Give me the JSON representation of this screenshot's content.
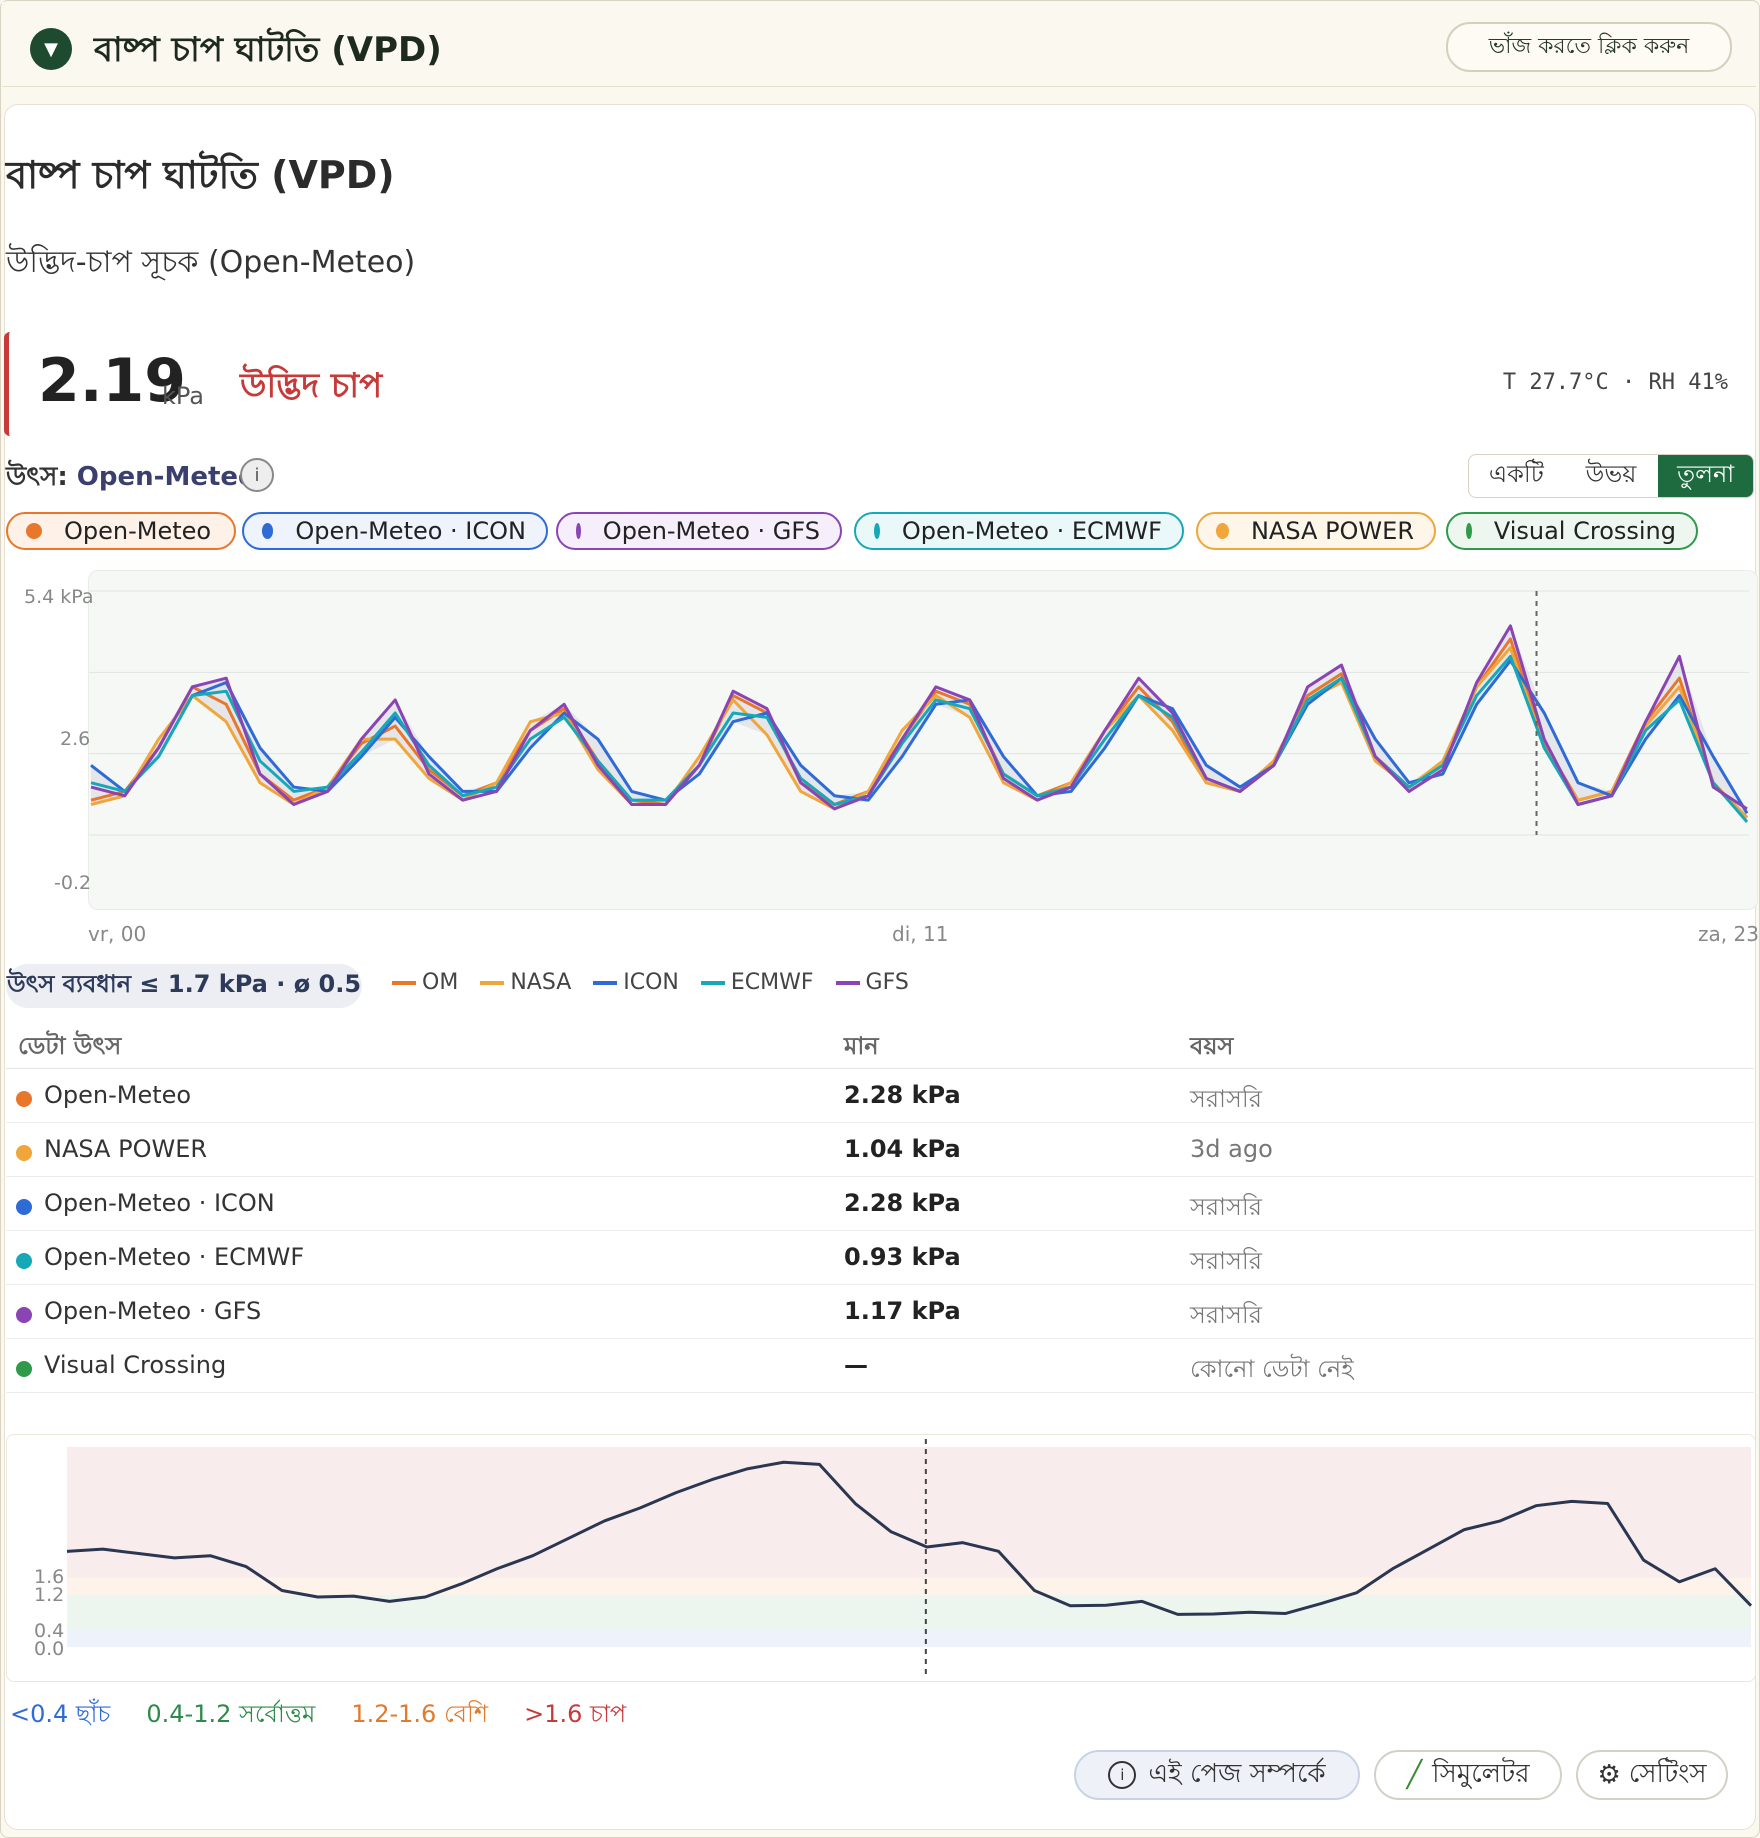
{
  "header": {
    "title": "বাষ্প চাপ ঘাটতি (VPD)",
    "collapse_label": "ভাঁজ করতে ক্লিক করুন",
    "chevron_icon": "chevron-down-icon"
  },
  "card": {
    "title": "বাষ্প চাপ ঘাটতি (VPD)",
    "subtitle": "উদ্ভিদ-চাপ সূচক (Open-Meteo)",
    "value": "2.19",
    "unit": "kPa",
    "status": "উদ্ভিদ চাপ",
    "status_color": "#c73a3a",
    "conditions": "T 27.7°C · RH 41%",
    "source_label": "উৎস:",
    "source_value": "Open-Meteo"
  },
  "view_toggle": {
    "options": [
      "একটি",
      "উভয়",
      "তুলনা"
    ],
    "selected": "তুলনা"
  },
  "chips": [
    {
      "label": "Open-Meteo",
      "color": "#e8772c",
      "bg": "#fdf1e8"
    },
    {
      "label": "Open-Meteo · ICON",
      "color": "#2f6bd6",
      "bg": "#eef3fc"
    },
    {
      "label": "Open-Meteo · GFS",
      "color": "#8a44b4",
      "bg": "#f6eefa"
    },
    {
      "label": "Open-Meteo · ECMWF",
      "color": "#17a8b8",
      "bg": "#ebf8fa"
    },
    {
      "label": "NASA POWER",
      "color": "#f0a63a",
      "bg": "#fdf6e9"
    },
    {
      "label": "Visual Crossing",
      "color": "#2e9a4a",
      "bg": "#edf7ef"
    }
  ],
  "chart_data": [
    {
      "type": "line",
      "title": "",
      "y_ticks": [
        "5.4 kPa",
        "2.6",
        "-0.2"
      ],
      "ylim": [
        -0.2,
        5.4
      ],
      "x_ticks": [
        "vr, 00",
        "di, 11",
        "za, 23"
      ],
      "now_marker_fraction": 0.872,
      "grid": true,
      "series": [
        {
          "name": "OM",
          "color": "#e8772c",
          "values": [
            0.6,
            0.8,
            1.8,
            3.2,
            2.8,
            1.2,
            0.6,
            0.9,
            1.9,
            2.3,
            1.3,
            0.7,
            1.0,
            2.2,
            2.7,
            1.5,
            0.6,
            0.5,
            1.4,
            3.0,
            2.6,
            1.0,
            0.5,
            0.8,
            2.0,
            3.1,
            2.8,
            1.2,
            0.7,
            1.0,
            2.2,
            3.2,
            2.4,
            1.0,
            0.8,
            1.5,
            3.0,
            3.5,
            1.6,
            0.9,
            1.4,
            3.2,
            4.3,
            1.9,
            0.6,
            0.8,
            2.4,
            3.4,
            1.0,
            0.2
          ]
        },
        {
          "name": "NASA",
          "color": "#f0a63a",
          "values": [
            0.5,
            0.7,
            2.0,
            3.0,
            2.4,
            1.0,
            0.5,
            0.9,
            2.0,
            2.0,
            1.1,
            0.6,
            1.0,
            2.4,
            2.6,
            1.3,
            0.5,
            0.5,
            1.6,
            2.9,
            2.1,
            0.8,
            0.4,
            0.8,
            2.2,
            3.0,
            2.5,
            1.0,
            0.6,
            1.0,
            2.2,
            3.0,
            2.2,
            1.0,
            0.8,
            1.5,
            2.9,
            3.3,
            1.5,
            0.9,
            1.5,
            3.2,
            4.1,
            1.8,
            0.6,
            0.8,
            2.3,
            3.2,
            1.0,
            0.2
          ]
        },
        {
          "name": "ICON",
          "color": "#2f6bd6",
          "values": [
            1.4,
            0.8,
            1.6,
            3.0,
            3.3,
            1.8,
            0.9,
            0.8,
            1.6,
            2.5,
            1.6,
            0.8,
            0.8,
            1.8,
            2.6,
            2.0,
            0.8,
            0.6,
            1.2,
            2.4,
            2.6,
            1.4,
            0.7,
            0.6,
            1.6,
            2.8,
            2.9,
            1.6,
            0.7,
            0.8,
            1.8,
            3.0,
            2.7,
            1.4,
            0.9,
            1.4,
            2.8,
            3.4,
            2.0,
            1.0,
            1.2,
            2.8,
            3.8,
            2.6,
            1.0,
            0.7,
            2.0,
            3.0,
            1.6,
            0.3
          ]
        },
        {
          "name": "ECMWF",
          "color": "#17a8b8",
          "values": [
            1.0,
            0.8,
            1.6,
            3.0,
            3.1,
            1.5,
            0.8,
            0.9,
            1.7,
            2.6,
            1.4,
            0.7,
            0.9,
            2.0,
            2.5,
            1.5,
            0.6,
            0.6,
            1.4,
            2.6,
            2.5,
            1.1,
            0.5,
            0.7,
            1.9,
            2.9,
            2.7,
            1.2,
            0.7,
            0.9,
            2.0,
            3.0,
            2.5,
            1.1,
            0.8,
            1.4,
            2.9,
            3.4,
            1.6,
            0.9,
            1.4,
            3.0,
            3.9,
            1.8,
            0.5,
            0.7,
            2.2,
            2.9,
            1.0,
            0.1
          ]
        },
        {
          "name": "GFS",
          "color": "#8a44b4",
          "values": [
            0.9,
            0.7,
            1.8,
            3.2,
            3.4,
            1.2,
            0.5,
            0.8,
            2.0,
            2.9,
            1.2,
            0.6,
            0.8,
            2.2,
            2.8,
            1.4,
            0.5,
            0.5,
            1.4,
            3.1,
            2.7,
            1.0,
            0.4,
            0.7,
            2.0,
            3.2,
            2.9,
            1.1,
            0.6,
            0.9,
            2.2,
            3.4,
            2.6,
            1.1,
            0.8,
            1.4,
            3.2,
            3.7,
            1.6,
            0.8,
            1.3,
            3.3,
            4.6,
            2.0,
            0.5,
            0.7,
            2.4,
            3.9,
            0.9,
            0.4
          ]
        }
      ]
    },
    {
      "type": "line",
      "title": "",
      "y_ticks": [
        "1.6",
        "1.2",
        "0.4",
        "0.0"
      ],
      "zones": [
        {
          "from": 0.0,
          "to": 0.4,
          "label": "<0.4 ছাঁচ"
        },
        {
          "from": 0.4,
          "to": 1.2,
          "label": "0.4-1.2 সর্বোত্তম"
        },
        {
          "from": 1.2,
          "to": 1.6,
          "label": "1.2-1.6 বেশি"
        },
        {
          "from": 1.6,
          "to": 4.6,
          "label": ">1.6 চাপ"
        }
      ],
      "ylim": [
        0,
        4.6
      ],
      "now_marker_fraction": 0.51,
      "series": [
        {
          "name": "VPD",
          "color": "#2b3650",
          "values": [
            2.2,
            2.25,
            2.15,
            2.05,
            2.1,
            1.85,
            1.3,
            1.15,
            1.17,
            1.05,
            1.15,
            1.45,
            1.8,
            2.1,
            2.5,
            2.9,
            3.2,
            3.55,
            3.85,
            4.1,
            4.25,
            4.2,
            3.3,
            2.65,
            2.3,
            2.4,
            2.2,
            1.3,
            0.95,
            0.96,
            1.05,
            0.75,
            0.76,
            0.8,
            0.77,
            1.0,
            1.25,
            1.8,
            2.25,
            2.7,
            2.9,
            3.25,
            3.35,
            3.3,
            2.0,
            1.5,
            1.8,
            0.95
          ]
        }
      ]
    }
  ],
  "spread_badge": "উৎস ব্যবধান ≤ 1.7 kPa · ø 0.5",
  "legend": [
    {
      "label": "OM",
      "color": "#e8772c"
    },
    {
      "label": "NASA",
      "color": "#f0a63a"
    },
    {
      "label": "ICON",
      "color": "#2f6bd6"
    },
    {
      "label": "ECMWF",
      "color": "#17a8b8"
    },
    {
      "label": "GFS",
      "color": "#8a44b4"
    }
  ],
  "table": {
    "headers": [
      "ডেটা উৎস",
      "মান",
      "বয়স"
    ],
    "rows": [
      {
        "source": "Open-Meteo",
        "value": "2.28 kPa",
        "age": "সরাসরি",
        "color": "#e8772c"
      },
      {
        "source": "NASA POWER",
        "value": "1.04 kPa",
        "age": "3d ago",
        "color": "#f0a63a"
      },
      {
        "source": "Open-Meteo · ICON",
        "value": "2.28 kPa",
        "age": "সরাসরি",
        "color": "#2f6bd6"
      },
      {
        "source": "Open-Meteo · ECMWF",
        "value": "0.93 kPa",
        "age": "সরাসরি",
        "color": "#17a8b8"
      },
      {
        "source": "Open-Meteo · GFS",
        "value": "1.17 kPa",
        "age": "সরাসরি",
        "color": "#8a44b4"
      },
      {
        "source": "Visual Crossing",
        "value": "—",
        "age": "কোনো ডেটা নেই",
        "color": "#2e9a4a"
      }
    ]
  },
  "zone_legend": [
    {
      "label": "<0.4 ছাঁচ",
      "color": "#2f6bd6"
    },
    {
      "label": "0.4-1.2 সর্বোত্তম",
      "color": "#2e8a4a"
    },
    {
      "label": "1.2-1.6 বেশি",
      "color": "#e07a2c"
    },
    {
      "label": ">1.6 চাপ",
      "color": "#c73a3a"
    }
  ],
  "footer": {
    "about": "এই পেজ সম্পর্কে",
    "simulator": "সিমুলেটর",
    "settings": "সেটিংস"
  }
}
